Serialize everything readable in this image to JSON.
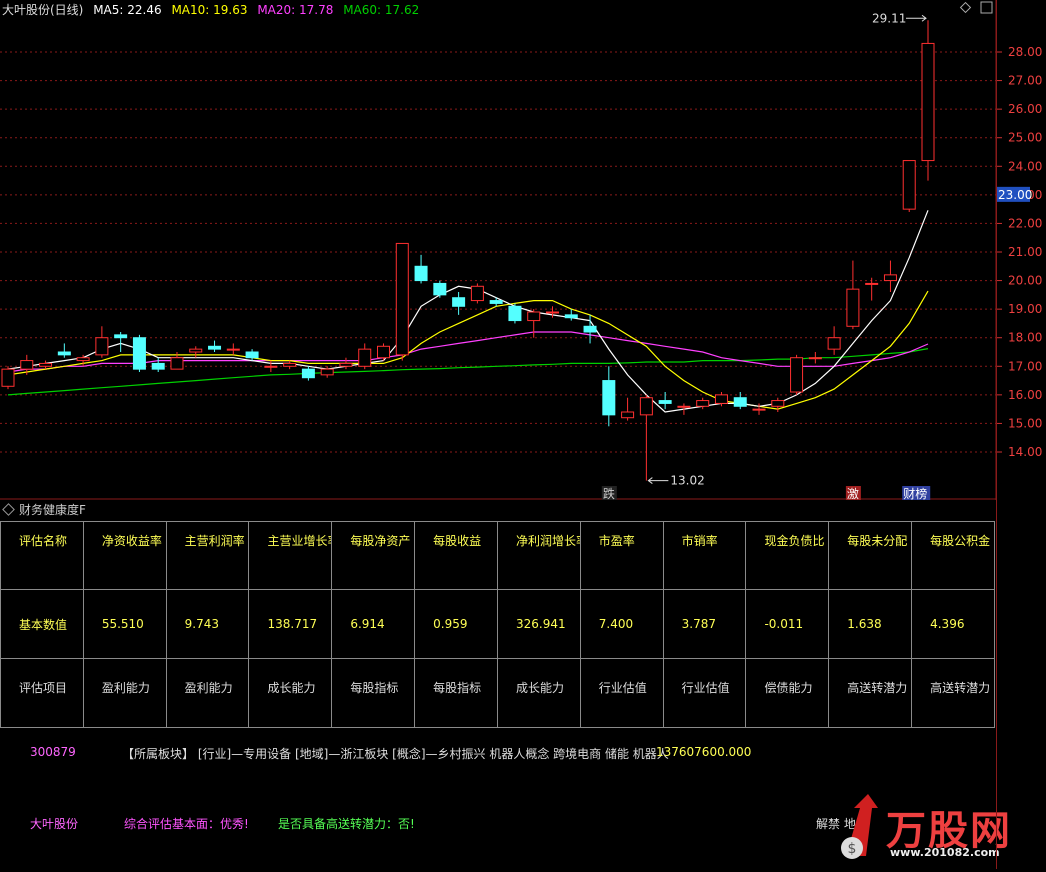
{
  "header": {
    "title": "大叶股份(日线)",
    "ma5": "MA5: 22.46",
    "ma10": "MA10: 19.63",
    "ma20": "MA20: 17.78",
    "ma60": "MA60: 17.62"
  },
  "colors": {
    "up": "#ff3030",
    "down": "#54ffff",
    "ma5": "#ffffff",
    "ma10": "#ffff00",
    "ma20": "#ff40ff",
    "ma60": "#00d000",
    "grid": "#8a1a1a"
  },
  "chart_data": {
    "type": "candlestick",
    "y_ticks": [
      "28.00",
      "27.00",
      "26.00",
      "25.00",
      "24.00",
      "23.00",
      "22.00",
      "21.00",
      "20.00",
      "19.00",
      "18.00",
      "17.00",
      "16.00",
      "15.00",
      "14.00"
    ],
    "ylim": [
      13.5,
      29.3
    ],
    "current_price_label": "23.00",
    "high_annotation": "29.11",
    "low_annotation": "13.02",
    "markers": [
      "跌",
      "激",
      "财榜"
    ],
    "candles": [
      {
        "o": 16.3,
        "c": 16.9,
        "h": 17.0,
        "l": 16.2
      },
      {
        "o": 16.9,
        "c": 17.2,
        "h": 17.4,
        "l": 16.7
      },
      {
        "o": 17.0,
        "c": 17.1,
        "h": 17.2,
        "l": 16.9
      },
      {
        "o": 17.5,
        "c": 17.4,
        "h": 17.8,
        "l": 17.3
      },
      {
        "o": 17.2,
        "c": 17.3,
        "h": 17.4,
        "l": 17.0
      },
      {
        "o": 17.4,
        "c": 18.0,
        "h": 18.4,
        "l": 17.3
      },
      {
        "o": 18.1,
        "c": 18.0,
        "h": 18.2,
        "l": 17.5
      },
      {
        "o": 18.0,
        "c": 16.9,
        "h": 18.1,
        "l": 16.8
      },
      {
        "o": 17.1,
        "c": 16.9,
        "h": 17.3,
        "l": 16.8
      },
      {
        "o": 16.9,
        "c": 17.3,
        "h": 17.5,
        "l": 16.9
      },
      {
        "o": 17.5,
        "c": 17.6,
        "h": 17.7,
        "l": 17.3
      },
      {
        "o": 17.7,
        "c": 17.6,
        "h": 17.9,
        "l": 17.5
      },
      {
        "o": 17.6,
        "c": 17.6,
        "h": 17.8,
        "l": 17.4
      },
      {
        "o": 17.5,
        "c": 17.3,
        "h": 17.6,
        "l": 17.2
      },
      {
        "o": 17.0,
        "c": 17.0,
        "h": 17.2,
        "l": 16.8
      },
      {
        "o": 17.0,
        "c": 17.1,
        "h": 17.2,
        "l": 16.9
      },
      {
        "o": 16.9,
        "c": 16.6,
        "h": 17.0,
        "l": 16.5
      },
      {
        "o": 16.7,
        "c": 16.9,
        "h": 17.0,
        "l": 16.6
      },
      {
        "o": 17.0,
        "c": 17.1,
        "h": 17.3,
        "l": 16.9
      },
      {
        "o": 17.0,
        "c": 17.6,
        "h": 17.8,
        "l": 16.9
      },
      {
        "o": 17.3,
        "c": 17.7,
        "h": 17.8,
        "l": 17.2
      },
      {
        "o": 17.4,
        "c": 21.3,
        "h": 21.3,
        "l": 17.2
      },
      {
        "o": 20.5,
        "c": 20.0,
        "h": 20.9,
        "l": 19.9
      },
      {
        "o": 19.9,
        "c": 19.5,
        "h": 20.0,
        "l": 19.4
      },
      {
        "o": 19.4,
        "c": 19.1,
        "h": 19.6,
        "l": 18.8
      },
      {
        "o": 19.3,
        "c": 19.8,
        "h": 19.9,
        "l": 19.2
      },
      {
        "o": 19.3,
        "c": 19.2,
        "h": 19.4,
        "l": 19.1
      },
      {
        "o": 19.1,
        "c": 18.6,
        "h": 19.2,
        "l": 18.5
      },
      {
        "o": 18.6,
        "c": 18.9,
        "h": 19.0,
        "l": 18.0
      },
      {
        "o": 18.9,
        "c": 18.9,
        "h": 19.1,
        "l": 18.7
      },
      {
        "o": 18.8,
        "c": 18.7,
        "h": 19.0,
        "l": 18.6
      },
      {
        "o": 18.4,
        "c": 18.2,
        "h": 18.8,
        "l": 17.8
      },
      {
        "o": 16.5,
        "c": 15.3,
        "h": 17.0,
        "l": 14.9
      },
      {
        "o": 15.2,
        "c": 15.4,
        "h": 15.9,
        "l": 15.1
      },
      {
        "o": 15.3,
        "c": 15.9,
        "h": 16.0,
        "l": 13.0
      },
      {
        "o": 15.8,
        "c": 15.7,
        "h": 16.1,
        "l": 15.5
      },
      {
        "o": 15.6,
        "c": 15.6,
        "h": 15.7,
        "l": 15.3
      },
      {
        "o": 15.6,
        "c": 15.8,
        "h": 15.9,
        "l": 15.5
      },
      {
        "o": 15.7,
        "c": 16.0,
        "h": 16.1,
        "l": 15.6
      },
      {
        "o": 15.9,
        "c": 15.6,
        "h": 16.1,
        "l": 15.5
      },
      {
        "o": 15.5,
        "c": 15.5,
        "h": 15.7,
        "l": 15.3
      },
      {
        "o": 15.6,
        "c": 15.8,
        "h": 15.9,
        "l": 15.4
      },
      {
        "o": 16.1,
        "c": 17.3,
        "h": 17.4,
        "l": 16.0
      },
      {
        "o": 17.3,
        "c": 17.3,
        "h": 17.5,
        "l": 17.1
      },
      {
        "o": 17.6,
        "c": 18.0,
        "h": 18.4,
        "l": 17.4
      },
      {
        "o": 18.4,
        "c": 19.7,
        "h": 20.7,
        "l": 18.3
      },
      {
        "o": 19.9,
        "c": 19.9,
        "h": 20.1,
        "l": 19.3
      },
      {
        "o": 20.0,
        "c": 20.2,
        "h": 20.7,
        "l": 19.6
      },
      {
        "o": 22.5,
        "c": 24.2,
        "h": 24.2,
        "l": 22.4
      },
      {
        "o": 24.2,
        "c": 28.3,
        "h": 29.11,
        "l": 23.5
      }
    ],
    "ma5": [
      16.9,
      17.0,
      17.1,
      17.2,
      17.3,
      17.6,
      17.8,
      17.6,
      17.3,
      17.3,
      17.3,
      17.3,
      17.3,
      17.2,
      17.1,
      17.1,
      17.0,
      16.9,
      17.0,
      17.1,
      17.2,
      18.0,
      19.1,
      19.5,
      19.8,
      19.7,
      19.4,
      19.1,
      18.9,
      18.8,
      18.7,
      18.6,
      17.6,
      16.7,
      16.0,
      15.4,
      15.5,
      15.6,
      15.7,
      15.7,
      15.6,
      15.7,
      16.0,
      16.4,
      17.0,
      17.8,
      18.6,
      19.3,
      20.8,
      22.46
    ],
    "ma10": [
      16.7,
      16.8,
      16.9,
      17.0,
      17.1,
      17.2,
      17.4,
      17.4,
      17.4,
      17.4,
      17.4,
      17.4,
      17.4,
      17.3,
      17.2,
      17.2,
      17.1,
      17.1,
      17.1,
      17.1,
      17.1,
      17.3,
      17.8,
      18.2,
      18.5,
      18.8,
      19.1,
      19.2,
      19.3,
      19.3,
      19.0,
      18.8,
      18.5,
      18.1,
      17.7,
      17.0,
      16.5,
      16.1,
      15.8,
      15.7,
      15.6,
      15.5,
      15.7,
      15.9,
      16.2,
      16.7,
      17.2,
      17.7,
      18.5,
      19.63
    ],
    "ma20": [
      16.8,
      16.9,
      16.9,
      17.0,
      17.0,
      17.1,
      17.1,
      17.1,
      17.2,
      17.2,
      17.2,
      17.2,
      17.2,
      17.2,
      17.2,
      17.2,
      17.2,
      17.2,
      17.2,
      17.2,
      17.3,
      17.4,
      17.6,
      17.7,
      17.8,
      17.9,
      18.0,
      18.1,
      18.2,
      18.2,
      18.2,
      18.1,
      18.0,
      17.9,
      17.8,
      17.7,
      17.6,
      17.5,
      17.3,
      17.2,
      17.1,
      17.0,
      17.0,
      17.0,
      17.0,
      17.1,
      17.2,
      17.3,
      17.5,
      17.78
    ],
    "ma60": [
      16.0,
      16.05,
      16.1,
      16.15,
      16.2,
      16.25,
      16.3,
      16.35,
      16.4,
      16.45,
      16.5,
      16.55,
      16.6,
      16.65,
      16.7,
      16.72,
      16.75,
      16.78,
      16.8,
      16.82,
      16.85,
      16.88,
      16.9,
      16.92,
      16.95,
      16.97,
      17.0,
      17.02,
      17.05,
      17.07,
      17.1,
      17.1,
      17.1,
      17.12,
      17.15,
      17.15,
      17.15,
      17.2,
      17.2,
      17.2,
      17.22,
      17.25,
      17.25,
      17.3,
      17.3,
      17.35,
      17.4,
      17.45,
      17.5,
      17.62
    ]
  },
  "indicator_name": "财务健康度F",
  "table": {
    "headers": [
      "评估名称",
      "净资收益率",
      "主营利润率",
      "主营业增长率",
      "每股净资产",
      "每股收益",
      "净利润增长率",
      "市盈率",
      "市销率",
      "现金负债比",
      "每股未分配",
      "每股公积金"
    ],
    "values": [
      "基本数值",
      "55.510",
      "9.743",
      "138.717",
      "6.914",
      "0.959",
      "326.941",
      "7.400",
      "3.787",
      "-0.011",
      "1.638",
      "4.396"
    ],
    "categories": [
      "评估项目",
      "盈利能力",
      "盈利能力",
      "成长能力",
      "每股指标",
      "每股指标",
      "成长能力",
      "行业估值",
      "行业估值",
      "偿债能力",
      "高送转潜力",
      "高送转潜力"
    ]
  },
  "info": {
    "code": "300879",
    "sector_text": "【所属板块】 [行业]—专用设备 [地域]—浙江板块 [概念]—乡村振兴 机器人概念 跨境电商 储能 机器人",
    "number": "137607600.000",
    "name": "大叶股份",
    "rating": "综合评估基本面：优秀!",
    "high_transfer": "是否具备高送转潜力：否!",
    "note": "解禁 地雷",
    "logo_text": "万股网",
    "logo_url": "www.201082.com"
  }
}
